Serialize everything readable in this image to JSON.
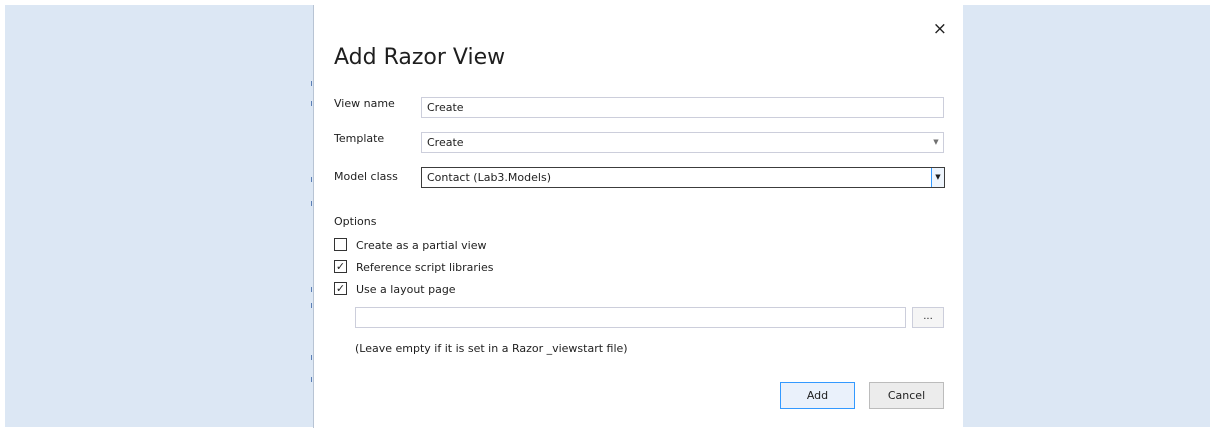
{
  "dialog": {
    "title": "Add Razor View",
    "close_icon": "×",
    "fields": {
      "view_name": {
        "label": "View name",
        "value": "Create"
      },
      "template": {
        "label": "Template",
        "value": "Create"
      },
      "model_class": {
        "label": "Model class",
        "value": "Contact (Lab3.Models)"
      }
    },
    "options": {
      "heading": "Options",
      "create_partial": {
        "label": "Create as a partial view",
        "checked": false,
        "mark": ""
      },
      "reference_scripts": {
        "label": "Reference script libraries",
        "checked": true,
        "mark": "✓"
      },
      "use_layout": {
        "label": "Use a layout page",
        "checked": true,
        "mark": "✓"
      },
      "layout_path_value": "",
      "browse_label": "...",
      "hint": "(Leave empty if it is set in a Razor _viewstart file)"
    },
    "buttons": {
      "add": "Add",
      "cancel": "Cancel"
    },
    "icons": {
      "dropdown": "chevron-down-icon",
      "dropdown_glyph": "▼",
      "close": "close-icon"
    }
  }
}
